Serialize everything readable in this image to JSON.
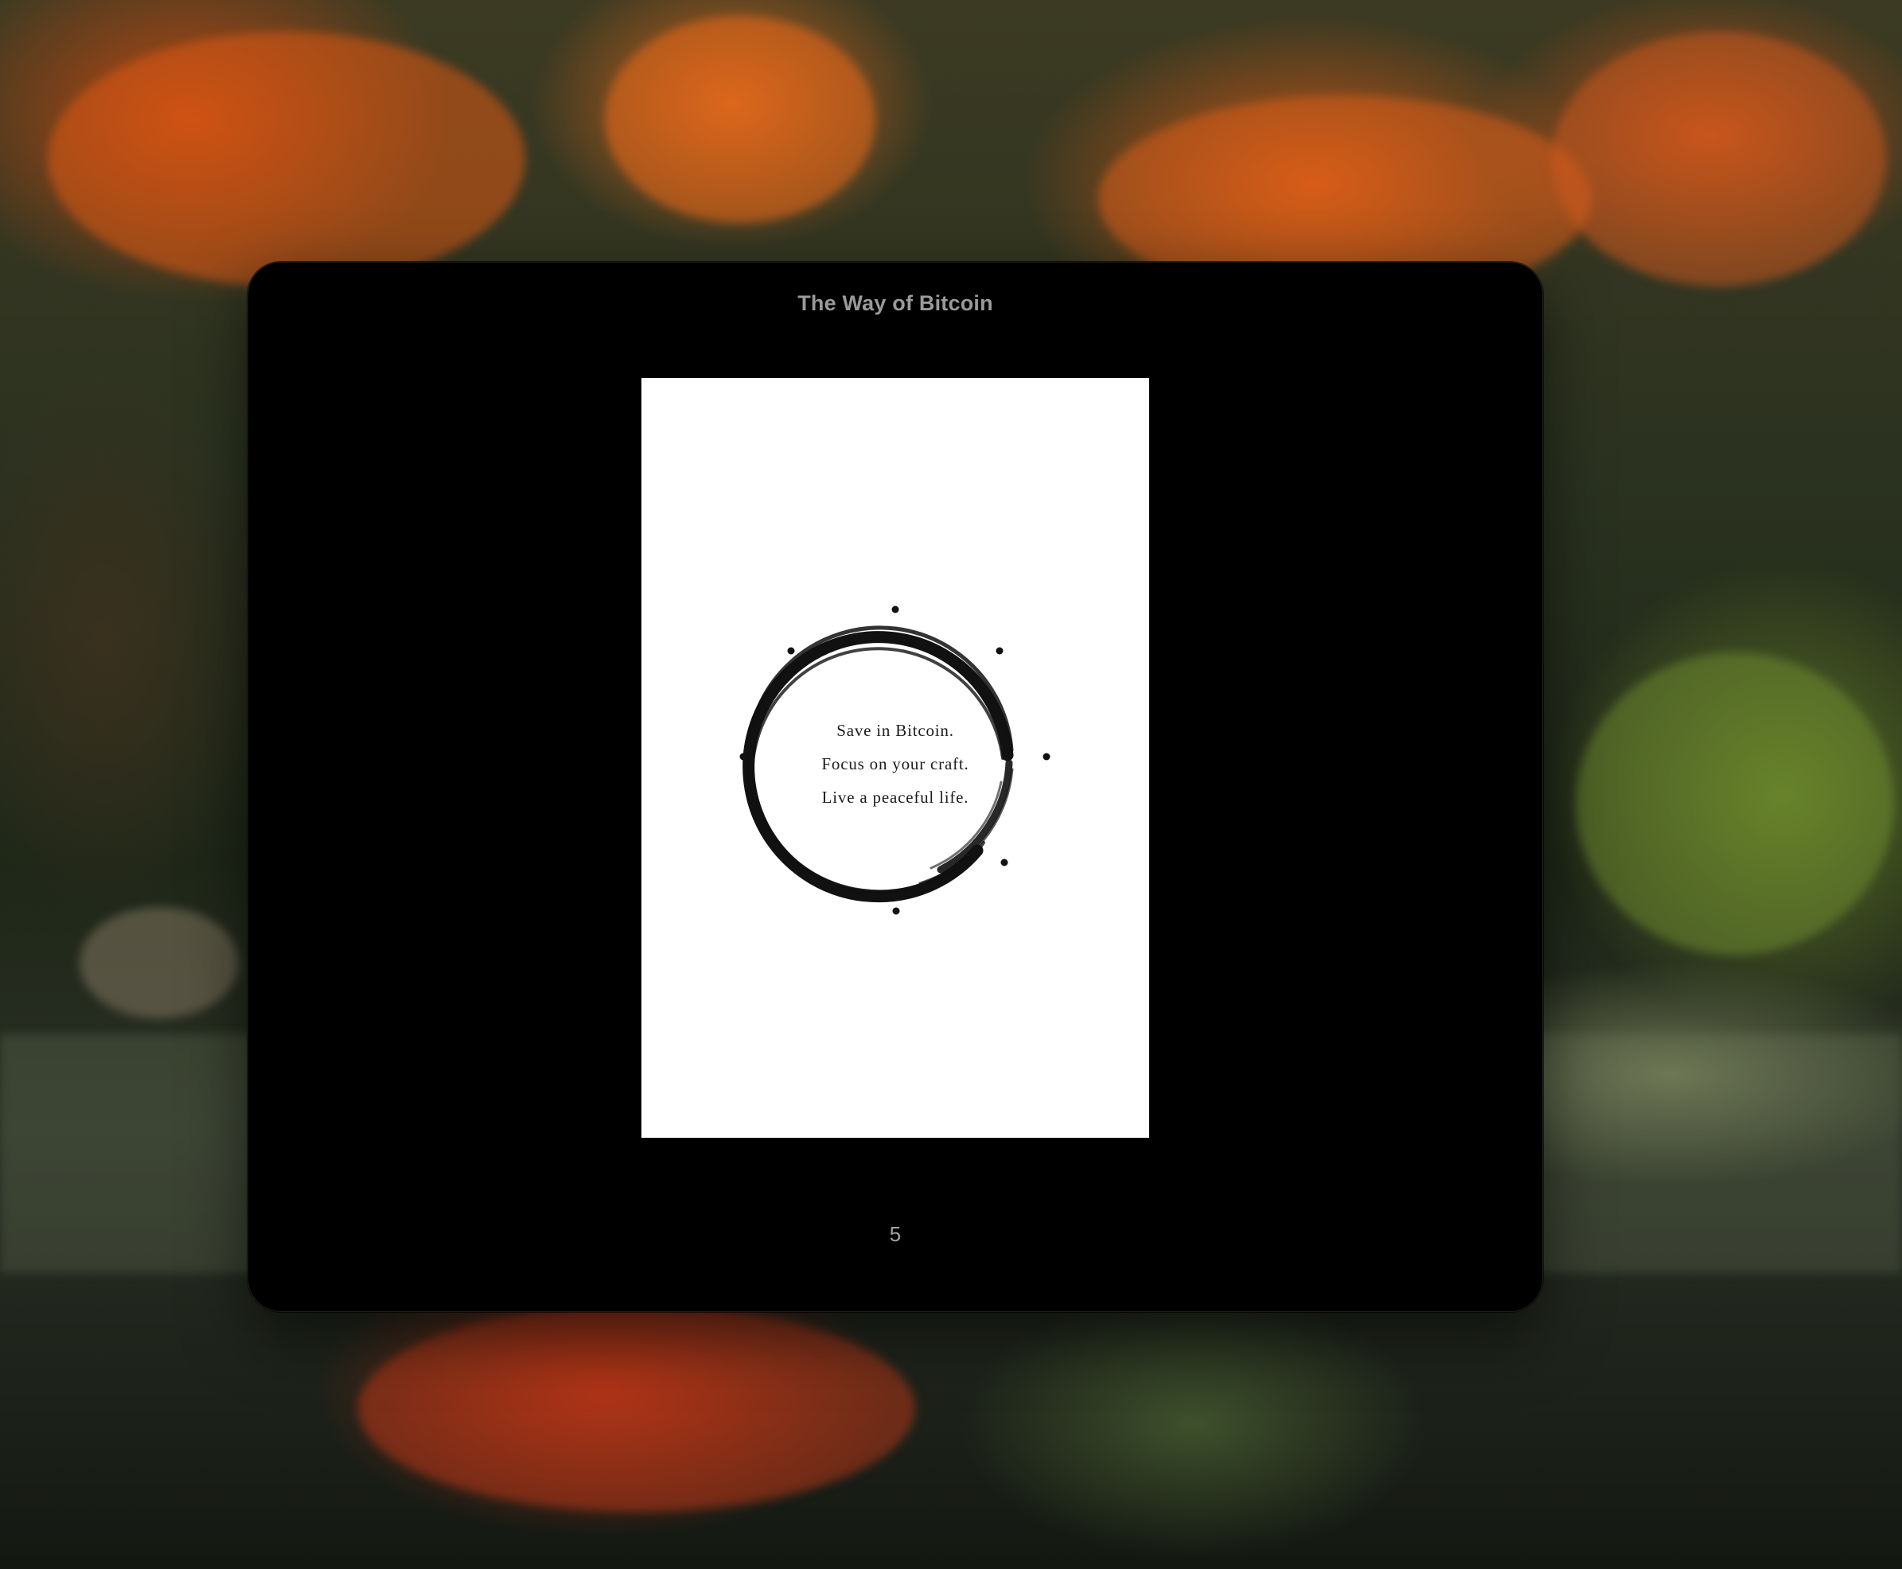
{
  "window": {
    "title": "The Way of Bitcoin",
    "page_number": "5"
  },
  "page": {
    "lines": [
      "Save in Bitcoin.",
      "Focus on your craft.",
      "Live a peaceful life."
    ]
  },
  "colors": {
    "window_background": "#000000",
    "page_background": "#ffffff",
    "title_text": "#9a9a9a",
    "ink": "#111111"
  }
}
